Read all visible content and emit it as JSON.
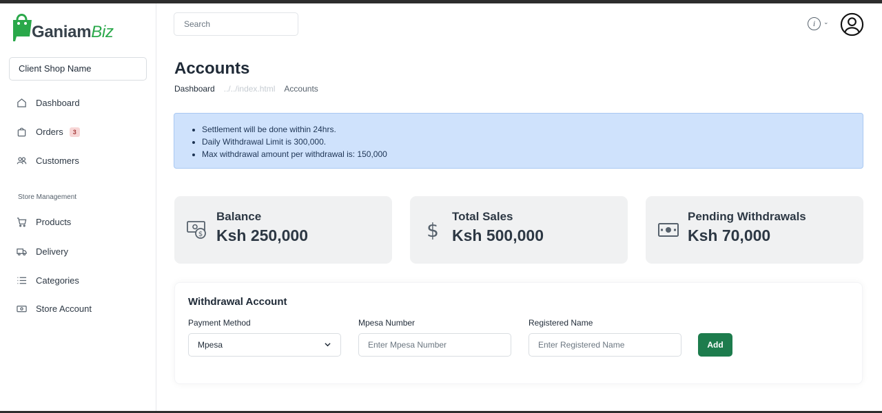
{
  "brand": {
    "name_main": "Ganiam",
    "name_accent": "Biz",
    "accent_color": "#2aa84a"
  },
  "sidebar": {
    "shop_name": "Client Shop Name",
    "items": [
      {
        "label": "Dashboard",
        "icon": "home-icon"
      },
      {
        "label": "Orders",
        "icon": "bag-icon",
        "badge": "3"
      },
      {
        "label": "Customers",
        "icon": "users-icon"
      }
    ],
    "section_label": "Store Management",
    "store_items": [
      {
        "label": "Products",
        "icon": "cart-icon"
      },
      {
        "label": "Delivery",
        "icon": "truck-icon"
      },
      {
        "label": "Categories",
        "icon": "list-icon"
      },
      {
        "label": "Store Account",
        "icon": "cash-icon"
      }
    ]
  },
  "header": {
    "search_placeholder": "Search",
    "info_icon": "info-icon",
    "avatar_icon": "user-circle-icon"
  },
  "page": {
    "title": "Accounts",
    "breadcrumb": [
      "Dashboard",
      "../../index.html",
      "Accounts"
    ]
  },
  "alert": {
    "items": [
      "Settlement will be done within 24hrs.",
      "Daily Withdrawal Limit is 300,000.",
      "Max withdrawal amount per withdrawal is: 150,000"
    ],
    "bg_color": "#cfe2fc"
  },
  "cards": [
    {
      "label": "Balance",
      "value": "Ksh 250,000",
      "icon": "money-coin-icon"
    },
    {
      "label": "Total Sales",
      "value": "Ksh 500,000",
      "icon": "dollar-icon"
    },
    {
      "label": "Pending Withdrawals",
      "value": "Ksh 70,000",
      "icon": "banknote-icon"
    }
  ],
  "withdrawal": {
    "title": "Withdrawal Account",
    "payment_method_label": "Payment Method",
    "payment_method_value": "Mpesa",
    "mpesa_label": "Mpesa Number",
    "mpesa_placeholder": "Enter Mpesa Number",
    "name_label": "Registered Name",
    "name_placeholder": "Enter Registered Name",
    "add_label": "Add",
    "button_color": "#1d7c4d"
  }
}
